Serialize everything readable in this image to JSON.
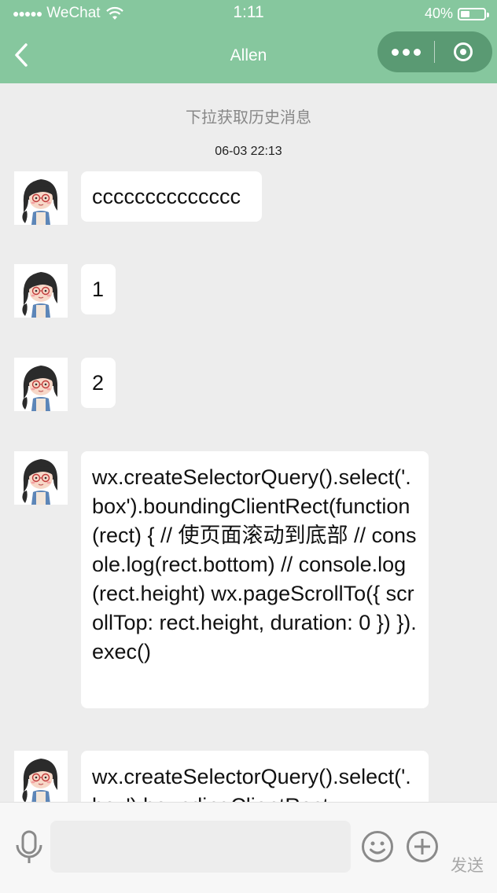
{
  "status_bar": {
    "carrier": "WeChat",
    "time": "1:11",
    "battery": "40%",
    "battery_level": 0.4
  },
  "nav": {
    "title": "Allen",
    "back_icon": "chevron-left-icon",
    "more_icon": "more-dots-icon",
    "close_icon": "target-close-icon"
  },
  "chat": {
    "history_hint": "下拉获取历史消息",
    "timestamp": "06-03 22:13",
    "messages": [
      {
        "text": "cccccccccccccc"
      },
      {
        "text": "1"
      },
      {
        "text": "2"
      },
      {
        "text": "wx.createSelectorQuery().select('.box').boundingClientRect(function (rect) { // 使页面滚动到底部 // console.log(rect.bottom) // console.log(rect.height) wx.pageScrollTo({ scrollTop: rect.height, duration: 0 }) }).exec()"
      },
      {
        "text": "wx.createSelectorQuery().select('.box').boundingClientRect"
      }
    ]
  },
  "input_bar": {
    "voice_icon": "microphone-icon",
    "input_value": "",
    "emoji_icon": "smiley-icon",
    "plus_icon": "plus-circle-icon",
    "send_label": "发送"
  },
  "colors": {
    "header": "#86c79e",
    "capsule": "#5a9a73",
    "background": "#ededed"
  }
}
